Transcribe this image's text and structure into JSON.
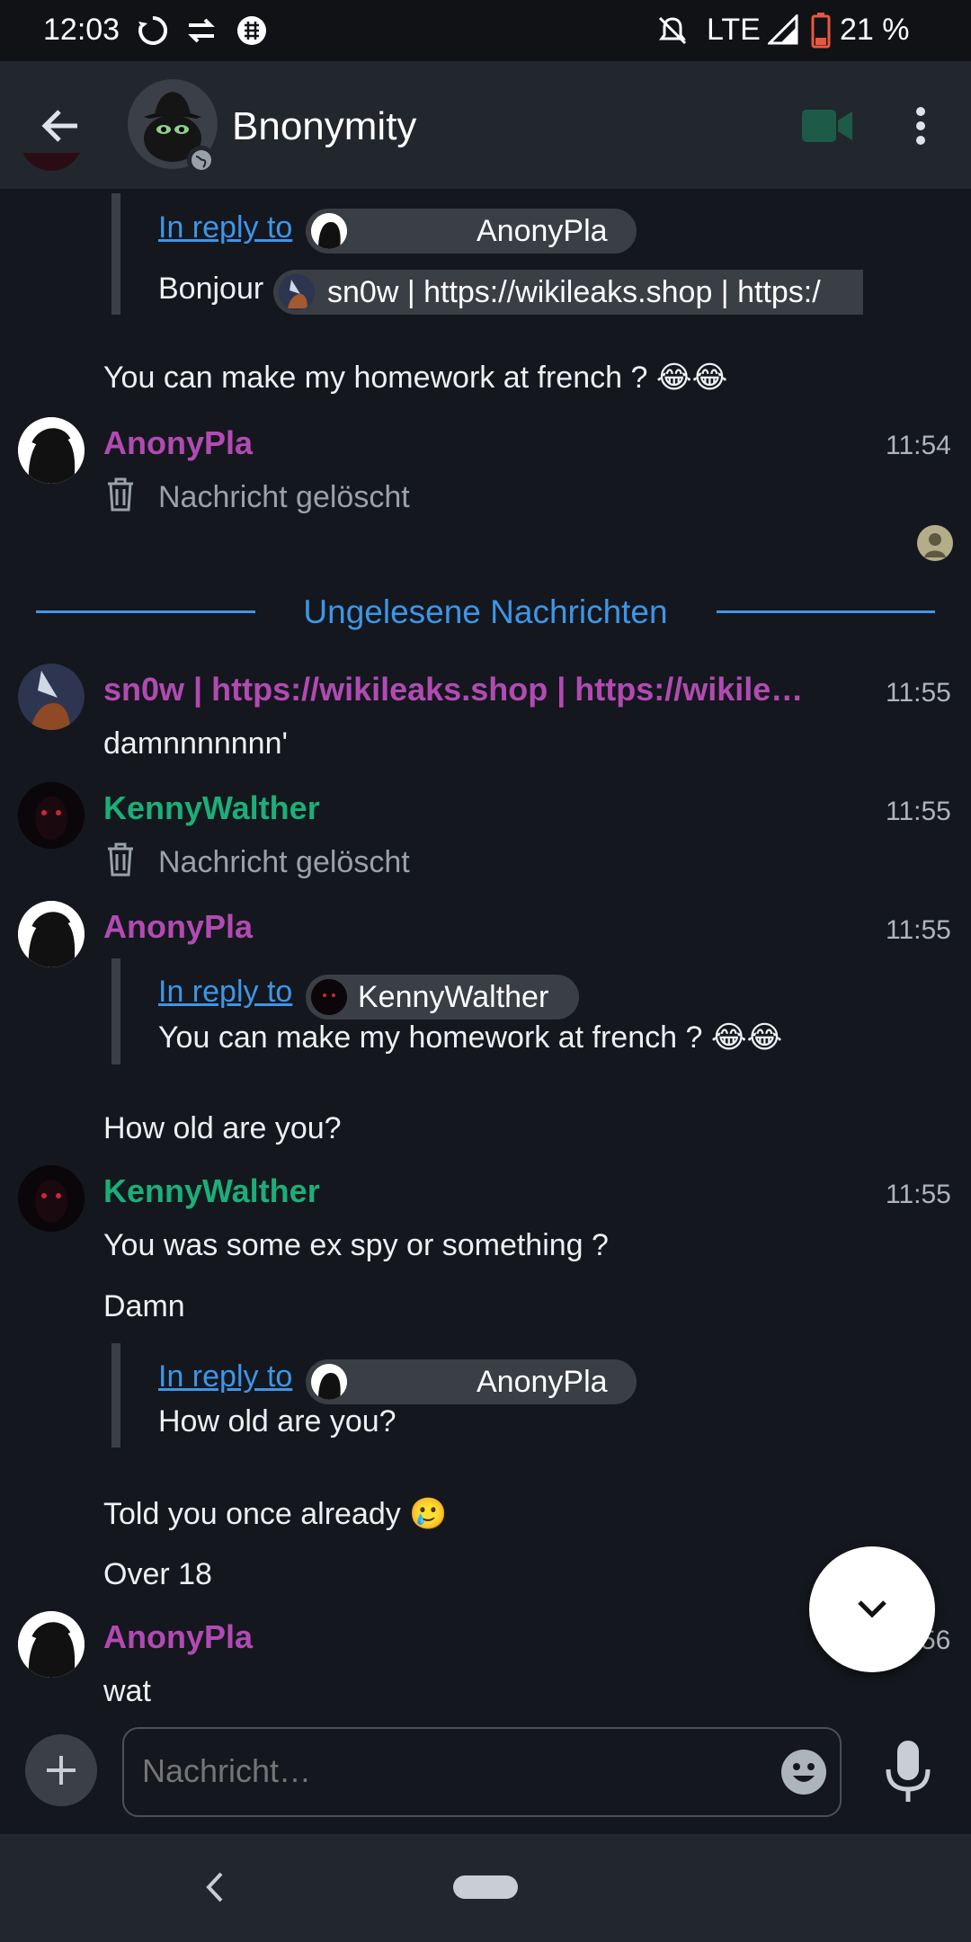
{
  "status": {
    "time": "12:03",
    "network": "LTE",
    "battery": "21 %"
  },
  "header": {
    "title": "Bnonymity"
  },
  "reply_label": "In reply to",
  "messages": {
    "m1": {
      "reply_to": "AnonyPla",
      "text_prefix": "Bonjour",
      "mention": "sn0w | https://wikileaks.shop | https:/"
    },
    "m2": {
      "text": "You can make my homework at french ? 😂😂"
    },
    "m3": {
      "sender": "AnonyPla",
      "time": "11:54",
      "deleted": "Nachricht gelöscht"
    },
    "unread_divider": "Ungelesene Nachrichten",
    "m4": {
      "sender": "sn0w | https://wikileaks.shop | https://wikile…",
      "time": "11:55",
      "text": "damnnnnnnn'"
    },
    "m5": {
      "sender": "KennyWalther",
      "time": "11:55",
      "deleted": "Nachricht gelöscht"
    },
    "m6": {
      "sender": "AnonyPla",
      "time": "11:55",
      "reply_to": "KennyWalther",
      "quoted": "You can make my homework at french ? 😂😂"
    },
    "m7": {
      "text": "How old are you?"
    },
    "m8": {
      "sender": "KennyWalther",
      "time": "11:55",
      "text1": "You was some ex spy or something ?",
      "text2": "Damn",
      "reply_to": "AnonyPla",
      "quoted": "How old are you?"
    },
    "m9": {
      "text1": "Told you once already 🥲",
      "text2": "Over 18"
    },
    "m10": {
      "sender": "AnonyPla",
      "time": "56",
      "text": "wat"
    }
  },
  "composer": {
    "placeholder": "Nachricht…"
  },
  "colors": {
    "background": "#14171d",
    "appbar": "#22262d",
    "purple_name": "#b24ab3",
    "green_name": "#1cae78",
    "link": "#3d96e8",
    "divider": "#3d96e8"
  }
}
